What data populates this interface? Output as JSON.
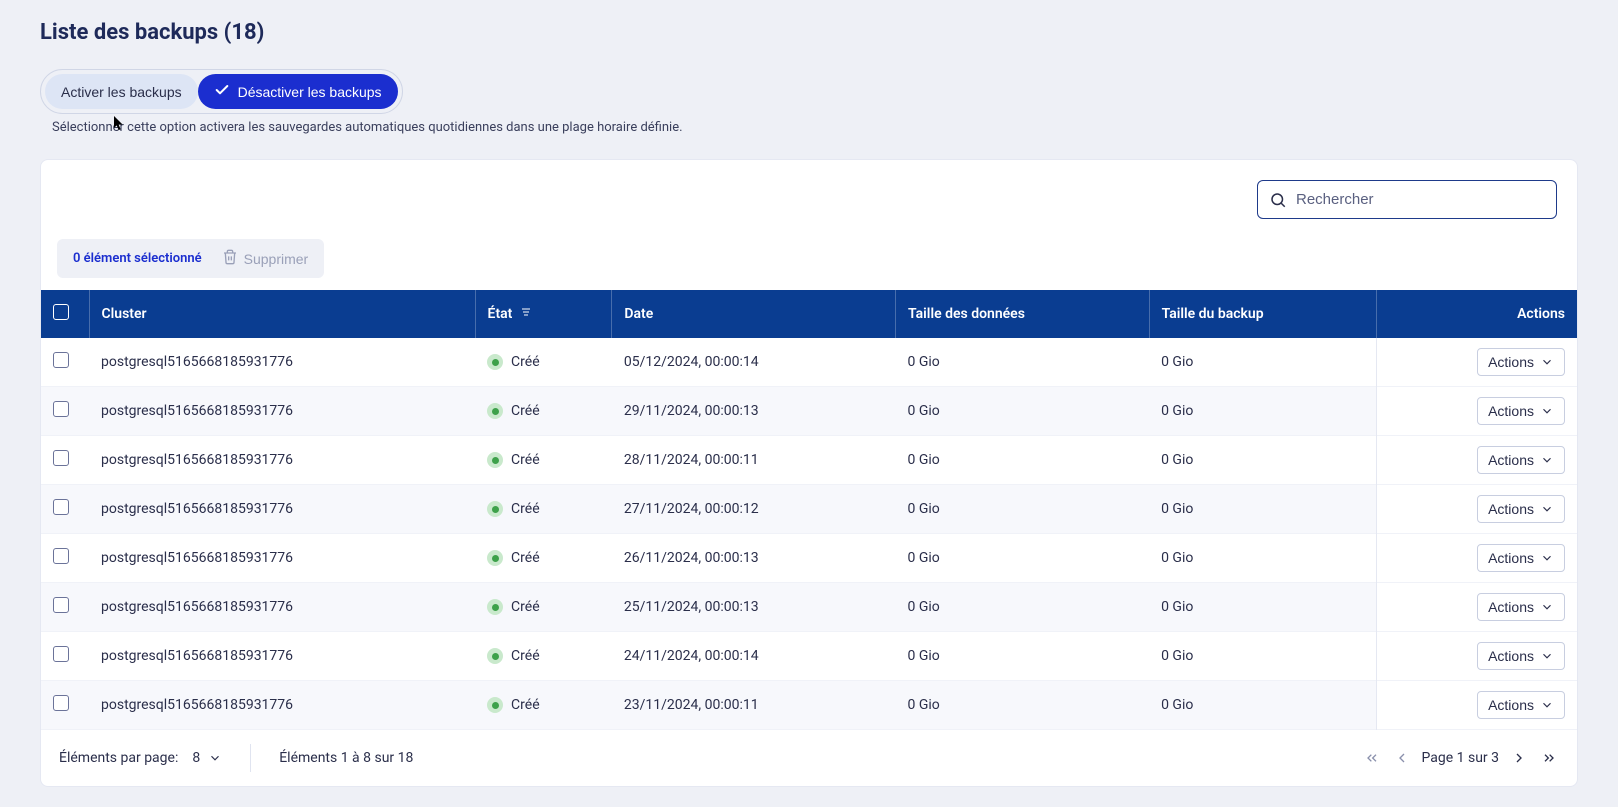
{
  "header": {
    "title": "Liste des backups (18)"
  },
  "toggles": {
    "activate_label": "Activer les backups",
    "deactivate_label": "Désactiver les backups",
    "hint": "Sélectionner cette option activera les sauvegardes automatiques quotidiennes dans une plage horaire définie."
  },
  "search": {
    "placeholder": "Rechercher"
  },
  "selection": {
    "count_label": "0 élément sélectionné",
    "delete_label": "Supprimer"
  },
  "columns": {
    "cluster": "Cluster",
    "state": "État",
    "date": "Date",
    "data_size": "Taille des données",
    "backup_size": "Taille du backup",
    "actions": "Actions"
  },
  "rows": [
    {
      "cluster": "postgresql5165668185931776",
      "state": "Créé",
      "date": "05/12/2024, 00:00:14",
      "data_size": "0 Gio",
      "backup_size": "0 Gio",
      "action_label": "Actions"
    },
    {
      "cluster": "postgresql5165668185931776",
      "state": "Créé",
      "date": "29/11/2024, 00:00:13",
      "data_size": "0 Gio",
      "backup_size": "0 Gio",
      "action_label": "Actions"
    },
    {
      "cluster": "postgresql5165668185931776",
      "state": "Créé",
      "date": "28/11/2024, 00:00:11",
      "data_size": "0 Gio",
      "backup_size": "0 Gio",
      "action_label": "Actions"
    },
    {
      "cluster": "postgresql5165668185931776",
      "state": "Créé",
      "date": "27/11/2024, 00:00:12",
      "data_size": "0 Gio",
      "backup_size": "0 Gio",
      "action_label": "Actions"
    },
    {
      "cluster": "postgresql5165668185931776",
      "state": "Créé",
      "date": "26/11/2024, 00:00:13",
      "data_size": "0 Gio",
      "backup_size": "0 Gio",
      "action_label": "Actions"
    },
    {
      "cluster": "postgresql5165668185931776",
      "state": "Créé",
      "date": "25/11/2024, 00:00:13",
      "data_size": "0 Gio",
      "backup_size": "0 Gio",
      "action_label": "Actions"
    },
    {
      "cluster": "postgresql5165668185931776",
      "state": "Créé",
      "date": "24/11/2024, 00:00:14",
      "data_size": "0 Gio",
      "backup_size": "0 Gio",
      "action_label": "Actions"
    },
    {
      "cluster": "postgresql5165668185931776",
      "state": "Créé",
      "date": "23/11/2024, 00:00:11",
      "data_size": "0 Gio",
      "backup_size": "0 Gio",
      "action_label": "Actions"
    }
  ],
  "footer": {
    "per_page_label": "Éléments par page:",
    "per_page_value": "8",
    "range_label": "Éléments 1 à 8 sur 18",
    "page_label": "Page 1 sur 3"
  }
}
